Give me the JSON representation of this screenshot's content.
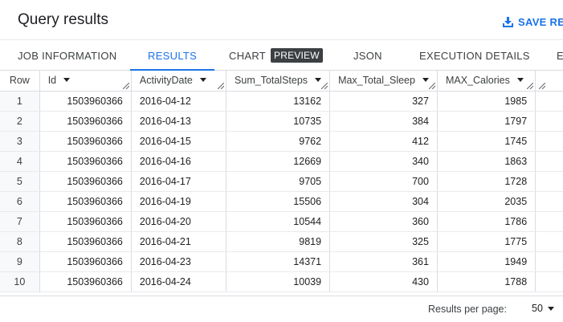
{
  "header": {
    "title": "Query results",
    "save_label": "SAVE RES",
    "accent_color": "#1a73e8"
  },
  "tabs": [
    {
      "label": "JOB INFORMATION"
    },
    {
      "label": "RESULTS",
      "active": true
    },
    {
      "label": "CHART",
      "badge": "PREVIEW"
    },
    {
      "label": "JSON"
    },
    {
      "label": "EXECUTION DETAILS"
    },
    {
      "label": "E"
    }
  ],
  "table": {
    "columns": [
      "Row",
      "Id",
      "ActivityDate",
      "Sum_TotalSteps",
      "Max_Total_Sleep",
      "MAX_Calories"
    ],
    "rows": [
      [
        "1",
        "1503960366",
        "2016-04-12",
        "13162",
        "327",
        "1985"
      ],
      [
        "2",
        "1503960366",
        "2016-04-13",
        "10735",
        "384",
        "1797"
      ],
      [
        "3",
        "1503960366",
        "2016-04-15",
        "9762",
        "412",
        "1745"
      ],
      [
        "4",
        "1503960366",
        "2016-04-16",
        "12669",
        "340",
        "1863"
      ],
      [
        "5",
        "1503960366",
        "2016-04-17",
        "9705",
        "700",
        "1728"
      ],
      [
        "6",
        "1503960366",
        "2016-04-19",
        "15506",
        "304",
        "2035"
      ],
      [
        "7",
        "1503960366",
        "2016-04-20",
        "10544",
        "360",
        "1786"
      ],
      [
        "8",
        "1503960366",
        "2016-04-21",
        "9819",
        "325",
        "1775"
      ],
      [
        "9",
        "1503960366",
        "2016-04-23",
        "14371",
        "361",
        "1949"
      ],
      [
        "10",
        "1503960366",
        "2016-04-24",
        "10039",
        "430",
        "1788"
      ]
    ]
  },
  "footer": {
    "results_per_page_label": "Results per page:",
    "results_per_page_value": "50"
  }
}
